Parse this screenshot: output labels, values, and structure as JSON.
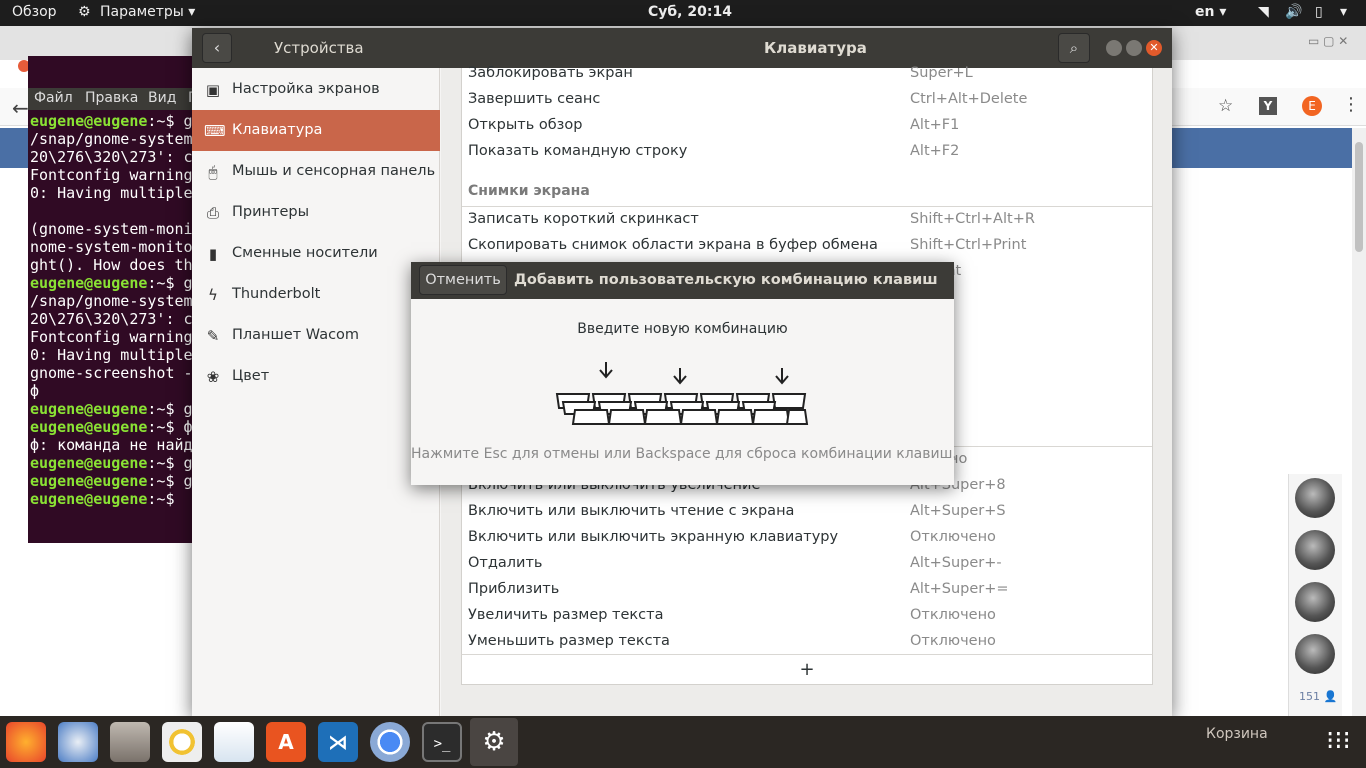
{
  "topbar": {
    "overview": "Обзор",
    "app_menu": "Параметры",
    "clock": "Суб, 20:14",
    "lang": "en"
  },
  "browser": {
    "menu": [
      "Файл",
      "Правка",
      "Вид",
      "П"
    ],
    "tab_icon": "Y",
    "avatar_letter": "E",
    "online_count": "151"
  },
  "terminal": {
    "lines": [
      {
        "prompt": "eugene@eugene",
        "rest": ":~$ g"
      },
      {
        "text": "/snap/gnome-system"
      },
      {
        "text": "20\\276\\320\\273': c"
      },
      {
        "text": "Fontconfig warning"
      },
      {
        "text": "0: Having multiple"
      },
      {
        "text": ""
      },
      {
        "text": "(gnome-system-moni"
      },
      {
        "text": "nome-system-monito"
      },
      {
        "text": "ght(). How does th"
      },
      {
        "prompt": "eugene@eugene",
        "rest": ":~$ g"
      },
      {
        "text": "/snap/gnome-system"
      },
      {
        "text": "20\\276\\320\\273': c"
      },
      {
        "text": "Fontconfig warning"
      },
      {
        "text": "0: Having multiple"
      },
      {
        "text": "gnome-screenshot -"
      },
      {
        "text": "ф"
      },
      {
        "prompt": "eugene@eugene",
        "rest": ":~$ g"
      },
      {
        "prompt": "eugene@eugene",
        "rest": ":~$ ф"
      },
      {
        "text": "ф: команда не найд"
      },
      {
        "prompt": "eugene@eugene",
        "rest": ":~$ g"
      },
      {
        "prompt": "eugene@eugene",
        "rest": ":~$ g"
      },
      {
        "prompt": "eugene@eugene",
        "rest": ":~$ "
      }
    ]
  },
  "settings": {
    "panel_title": "Устройства",
    "window_title": "Клавиатура",
    "sidebar": [
      {
        "label": "Настройка экранов",
        "icon": "display-icon"
      },
      {
        "label": "Клавиатура",
        "icon": "keyboard-icon",
        "active": true
      },
      {
        "label": "Мышь и сенсорная панель",
        "icon": "mouse-icon"
      },
      {
        "label": "Принтеры",
        "icon": "printer-icon"
      },
      {
        "label": "Сменные носители",
        "icon": "usb-icon"
      },
      {
        "label": "Thunderbolt",
        "icon": "thunderbolt-icon"
      },
      {
        "label": "Планшет Wacom",
        "icon": "tablet-icon"
      },
      {
        "label": "Цвет",
        "icon": "color-icon"
      }
    ],
    "rows_top": [
      {
        "name": "Заблокировать экран",
        "key": "Super+L"
      },
      {
        "name": "Завершить сеанс",
        "key": "Ctrl+Alt+Delete"
      },
      {
        "name": "Открыть обзор",
        "key": "Alt+F1"
      },
      {
        "name": "Показать командную строку",
        "key": "Alt+F2"
      }
    ],
    "section_screenshots": "Снимки экрана",
    "rows_shots": [
      {
        "name": "Записать короткий скринкаст",
        "key": "Shift+Ctrl+Alt+R"
      },
      {
        "name": "Скопировать снимок области экрана в буфер обмена",
        "key": "Shift+Ctrl+Print"
      },
      {
        "name": "",
        "key": "t+Print"
      },
      {
        "name": "",
        "key": "rint"
      },
      {
        "name": "",
        "key": ""
      },
      {
        "name": "",
        "key": "Print"
      },
      {
        "name": "",
        "key": "int"
      }
    ],
    "rows_access": [
      {
        "name": "",
        "key": "лючено"
      },
      {
        "name": "Включить или выключить увеличение",
        "key": "Alt+Super+8"
      },
      {
        "name": "Включить или выключить чтение с экрана",
        "key": "Alt+Super+S"
      },
      {
        "name": "Включить или выключить экранную клавиатуру",
        "key": "Отключено"
      },
      {
        "name": "Отдалить",
        "key": "Alt+Super+-"
      },
      {
        "name": "Приблизить",
        "key": "Alt+Super+="
      },
      {
        "name": "Увеличить размер текста",
        "key": "Отключено"
      },
      {
        "name": "Уменьшить размер текста",
        "key": "Отключено"
      }
    ],
    "add_label": "+"
  },
  "dialog": {
    "cancel": "Отменить",
    "title": "Добавить пользовательскую комбинацию клавиш",
    "prompt": "Введите новую комбинацию",
    "hint": "Нажмите Esc для отмены или Backspace для сброса комбинации клавиш."
  },
  "dock": {
    "items": [
      "firefox-icon",
      "thunderbird-icon",
      "files-icon",
      "rhythmbox-icon",
      "libreoffice-impress-icon",
      "software-center-icon",
      "vscode-icon",
      "chromium-icon",
      "terminal-icon",
      "settings-icon"
    ],
    "trash_label": "Корзина"
  }
}
